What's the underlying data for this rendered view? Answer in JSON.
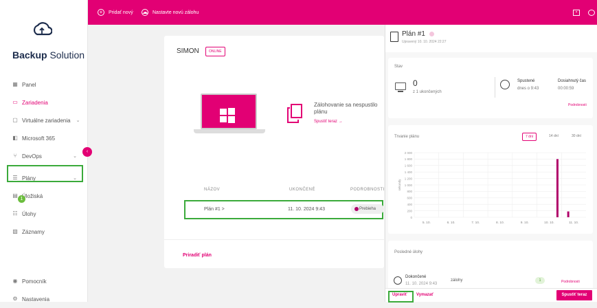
{
  "brand": {
    "bold": "Backup",
    "rest": " Solution"
  },
  "sidebar": {
    "items": [
      {
        "label": "Panel",
        "icon": "grid-icon"
      },
      {
        "label": "Zariadenia",
        "icon": "devices-icon",
        "active": true
      },
      {
        "label": "Virtuálne zariadenia",
        "icon": "monitor-icon",
        "chevron": "⌄"
      },
      {
        "label": "Microsoft 365",
        "icon": "microsoft-icon"
      },
      {
        "label": "DevOps",
        "icon": "branch-icon",
        "chevron": "⌄"
      },
      {
        "label": "Plány",
        "icon": "list-icon",
        "chevron": "⌄"
      },
      {
        "label": "Úložiská",
        "icon": "storage-icon"
      },
      {
        "label": "Úlohy",
        "icon": "tasks-icon",
        "badge": "1"
      },
      {
        "label": "Záznamy",
        "icon": "log-icon"
      }
    ],
    "bottom": [
      {
        "label": "Pomocník",
        "icon": "help-icon"
      },
      {
        "label": "Nastavenia",
        "icon": "settings-icon"
      }
    ]
  },
  "topbar": {
    "add_new": "Pridať nový",
    "setup_backup": "Nastavte novú zálohu"
  },
  "device": {
    "name": "SIMON",
    "status": "ONLINE",
    "backup_message": "Zálohovanie sa nespustilo plánu",
    "run_now_link": "Spustiť teraz →",
    "columns": {
      "name": "NÁZOV",
      "finished": "UKONČENÉ",
      "details": "PODROBNOSTI"
    },
    "row": {
      "name": "Plán #1 >",
      "finished": "11. 10. 2024 9:43",
      "status": "Prebieha"
    },
    "assign_plan": "Priradiť plán"
  },
  "panel": {
    "title": "Plán #1",
    "subtitle": "Upravený 10. 10. 2024 22:27",
    "status_label": "Stav",
    "count": "0",
    "count_of": "z 1 ukončených",
    "started_label": "Spustené",
    "started_value": "dnes o 9:43",
    "duration_label": "Dosiahnutý čas",
    "duration_value": "00:00:59",
    "details_link": "Podrobnosti",
    "chart_title": "Trvanie plánu",
    "ranges": [
      "7 dní",
      "14 dní",
      "30 dní"
    ],
    "tasks_title": "Posledné úlohy",
    "task_status": "Dokončené",
    "task_type": "zálohy",
    "task_date": "11. 10. 2024 9:43",
    "task_count": "1",
    "task_link": "Podrobnosti",
    "edit": "Upraviť",
    "delete": "Vymazať",
    "run_now": "Spustiť teraz"
  },
  "chart_data": {
    "type": "bar",
    "title": "Trvanie plánu",
    "categories": [
      "5. 10.",
      "6. 10.",
      "7. 10.",
      "8. 10.",
      "9. 10.",
      "10. 10.",
      "11. 10."
    ],
    "values": [
      0,
      0,
      0,
      0,
      0,
      1800,
      180
    ],
    "ylabel": "sekundy",
    "ylim": [
      0,
      2000
    ],
    "yticks": [
      "2 000",
      "1 800",
      "1 600",
      "1 400",
      "1 200",
      "1 000",
      "800",
      "600",
      "400",
      "200",
      "0"
    ],
    "grid": true,
    "color": "#b0006a"
  }
}
